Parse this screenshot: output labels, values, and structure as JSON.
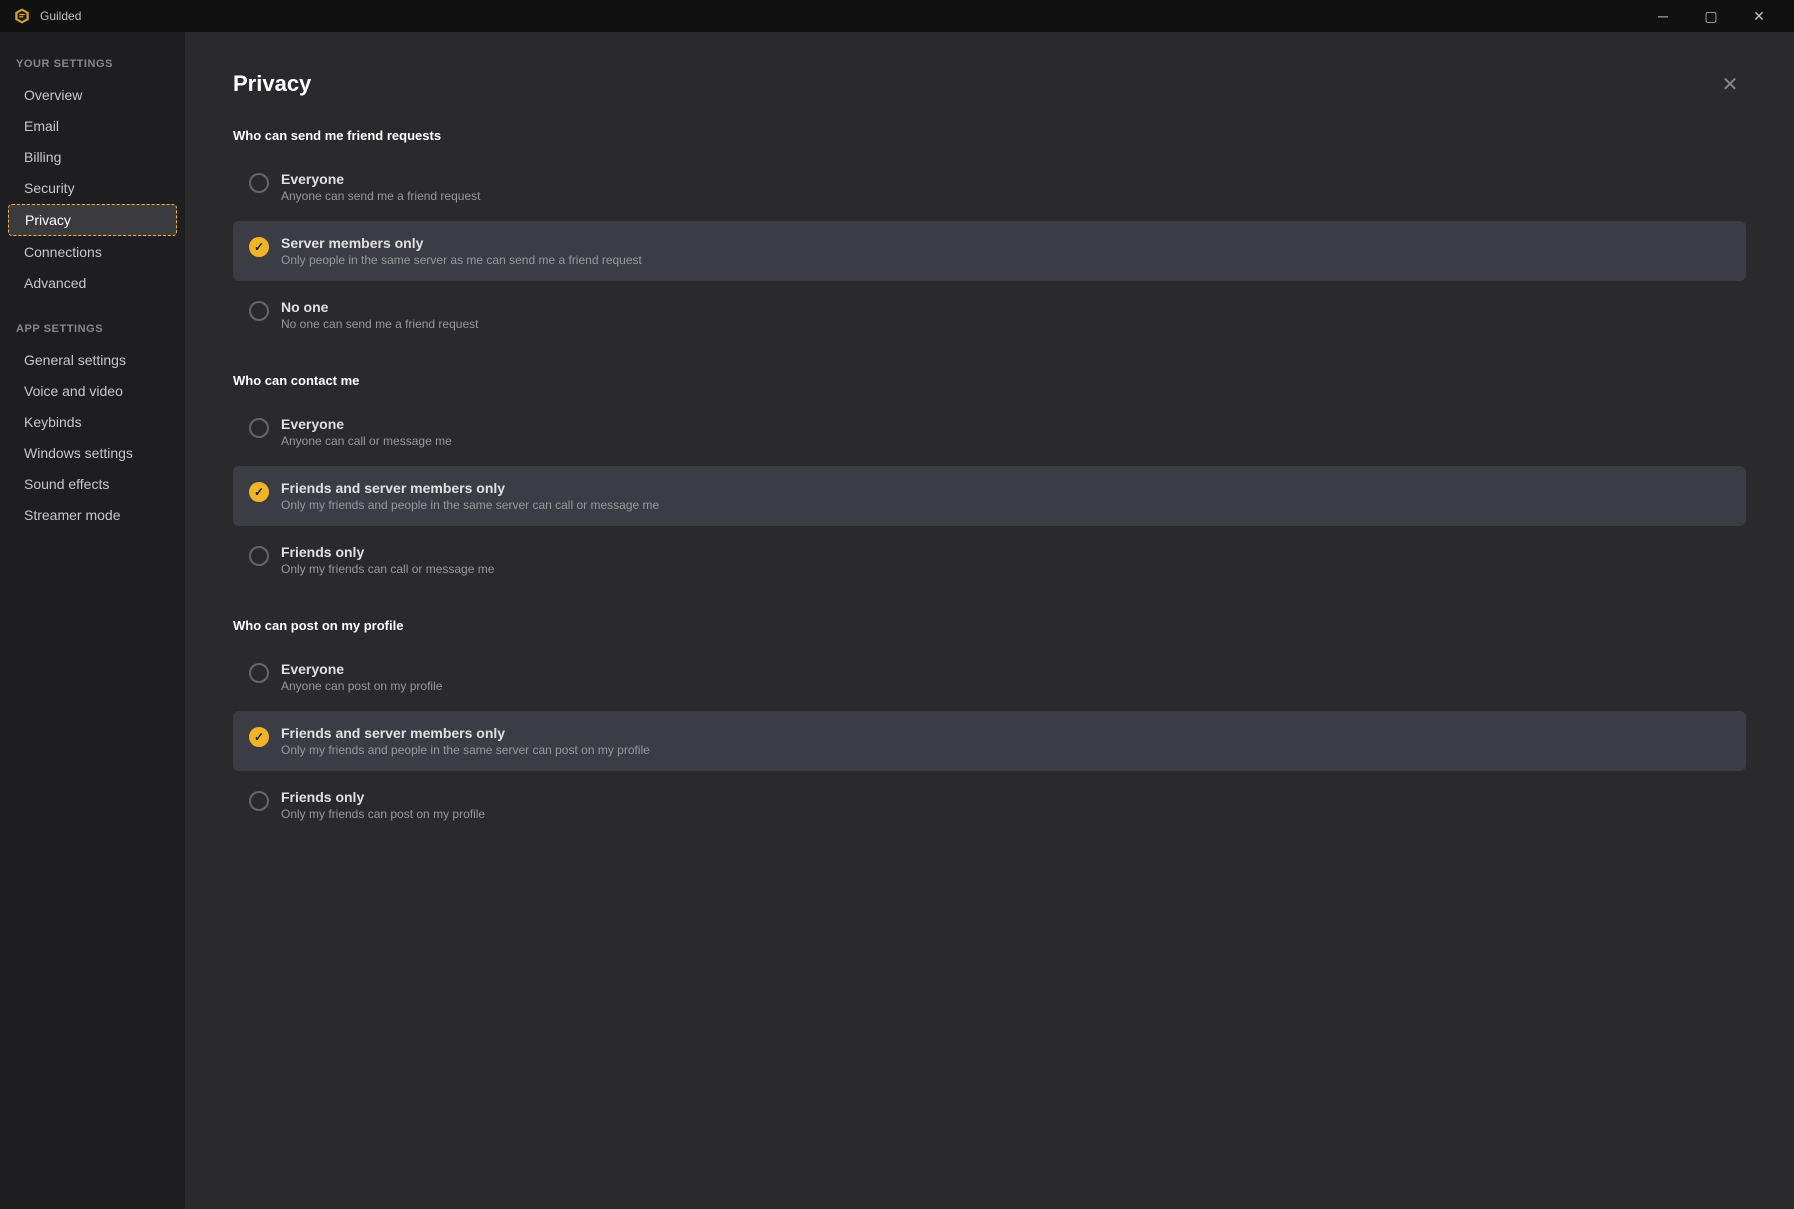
{
  "titlebar": {
    "logo_alt": "Guilded logo",
    "title": "Guilded",
    "minimize_label": "minimize",
    "maximize_label": "maximize",
    "close_label": "close",
    "minimize_symbol": "─",
    "maximize_symbol": "▢",
    "close_symbol": "✕"
  },
  "sidebar": {
    "your_settings_label": "Your settings",
    "app_settings_label": "App settings",
    "items_your": [
      {
        "id": "overview",
        "label": "Overview",
        "active": false
      },
      {
        "id": "email",
        "label": "Email",
        "active": false
      },
      {
        "id": "billing",
        "label": "Billing",
        "active": false
      },
      {
        "id": "security",
        "label": "Security",
        "active": false
      },
      {
        "id": "privacy",
        "label": "Privacy",
        "active": true
      },
      {
        "id": "connections",
        "label": "Connections",
        "active": false
      },
      {
        "id": "advanced",
        "label": "Advanced",
        "active": false
      }
    ],
    "items_app": [
      {
        "id": "general-settings",
        "label": "General settings",
        "active": false
      },
      {
        "id": "voice-and-video",
        "label": "Voice and video",
        "active": false
      },
      {
        "id": "keybinds",
        "label": "Keybinds",
        "active": false
      },
      {
        "id": "windows-settings",
        "label": "Windows settings",
        "active": false
      },
      {
        "id": "sound-effects",
        "label": "Sound effects",
        "active": false
      },
      {
        "id": "streamer-mode",
        "label": "Streamer mode",
        "active": false
      }
    ]
  },
  "page": {
    "title": "Privacy",
    "close_label": "✕"
  },
  "sections": [
    {
      "id": "friend-requests",
      "heading": "Who can send me friend requests",
      "options": [
        {
          "id": "everyone",
          "title": "Everyone",
          "desc": "Anyone can send me a friend request",
          "selected": false
        },
        {
          "id": "server-members-only",
          "title": "Server members only",
          "desc": "Only people in the same server as me can send me a friend request",
          "selected": true
        },
        {
          "id": "no-one",
          "title": "No one",
          "desc": "No one can send me a friend request",
          "selected": false
        }
      ]
    },
    {
      "id": "contact",
      "heading": "Who can contact me",
      "options": [
        {
          "id": "everyone",
          "title": "Everyone",
          "desc": "Anyone can call or message me",
          "selected": false
        },
        {
          "id": "friends-and-server",
          "title": "Friends and server members only",
          "desc": "Only my friends and people in the same server can call or message me",
          "selected": true
        },
        {
          "id": "friends-only",
          "title": "Friends only",
          "desc": "Only my friends can call or message me",
          "selected": false
        }
      ]
    },
    {
      "id": "profile-posts",
      "heading": "Who can post on my profile",
      "options": [
        {
          "id": "everyone",
          "title": "Everyone",
          "desc": "Anyone can post on my profile",
          "selected": false
        },
        {
          "id": "friends-and-server",
          "title": "Friends and server members only",
          "desc": "Only my friends and people in the same server can post on my profile",
          "selected": true
        },
        {
          "id": "friends-only",
          "title": "Friends only",
          "desc": "Only my friends can post on my profile",
          "selected": false
        }
      ]
    }
  ],
  "colors": {
    "accent": "#f0b429",
    "sidebar_bg": "#1e1e21",
    "content_bg": "#2a2a2d",
    "selected_bg": "#3c3c45",
    "titlebar_bg": "#111111"
  }
}
